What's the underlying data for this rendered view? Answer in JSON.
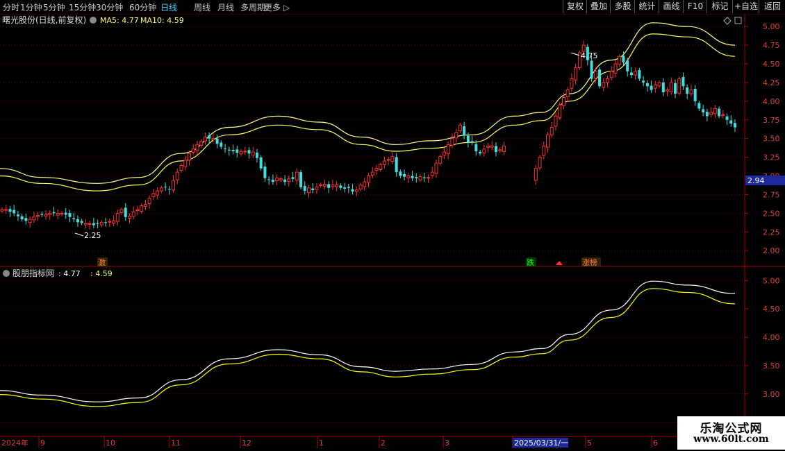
{
  "toolbar": {
    "periods": [
      "分时",
      "1分钟",
      "5分钟",
      "15分钟",
      "30分钟",
      "60分钟",
      "日线",
      "周线",
      "月线",
      "多周期",
      "更多"
    ],
    "active_period": "日线",
    "right_buttons": [
      "复权",
      "叠加",
      "多股",
      "统计",
      "画线",
      "F10",
      "标记",
      "+自选",
      "返回"
    ]
  },
  "upper_panel": {
    "title": "曙光股份(日线,前复权)",
    "ma5_label": "MA5: 4.77",
    "ma10_label": "MA10: 4.59",
    "ma5_color": "#ffffff",
    "ma10_color": "#ffff00",
    "current_price_tag": "2.94",
    "high_marker": "4.75",
    "low_marker": "2.25",
    "event_tags": [
      {
        "text": "激",
        "color": "#ff8040"
      },
      {
        "text": "跌",
        "color": "#00ff00"
      },
      {
        "text": "涨榜",
        "color": "#ff8040"
      }
    ]
  },
  "lower_panel": {
    "title": "股朋指标网",
    "value1": ": 4.77",
    "value2": ": 4.59"
  },
  "x_axis": {
    "labels": [
      "2024年",
      "9",
      "10",
      "11",
      "12",
      "1",
      "2",
      "3",
      "2025/03/31/一",
      "5",
      "6"
    ]
  },
  "chart_data": [
    {
      "type": "candlestick",
      "ylim": [
        1.9,
        5.15
      ],
      "yticks": [
        2.0,
        2.25,
        2.5,
        2.75,
        3.0,
        3.25,
        3.5,
        3.75,
        4.0,
        4.25,
        4.5,
        4.75,
        5.0
      ],
      "bands": {
        "upper": [
          [
            0,
            3.1
          ],
          [
            60,
            2.98
          ],
          [
            140,
            2.9
          ],
          [
            200,
            2.98
          ],
          [
            260,
            3.3
          ],
          [
            330,
            3.65
          ],
          [
            400,
            3.8
          ],
          [
            460,
            3.72
          ],
          [
            520,
            3.52
          ],
          [
            570,
            3.42
          ],
          [
            620,
            3.47
          ],
          [
            680,
            3.55
          ],
          [
            740,
            3.8
          ],
          [
            780,
            3.85
          ],
          [
            820,
            4.1
          ],
          [
            880,
            4.55
          ],
          [
            940,
            5.05
          ],
          [
            990,
            5.0
          ],
          [
            1058,
            4.75
          ]
        ],
        "lower": [
          [
            0,
            3.0
          ],
          [
            60,
            2.9
          ],
          [
            140,
            2.8
          ],
          [
            200,
            2.88
          ],
          [
            260,
            3.2
          ],
          [
            330,
            3.55
          ],
          [
            400,
            3.68
          ],
          [
            460,
            3.62
          ],
          [
            520,
            3.42
          ],
          [
            570,
            3.33
          ],
          [
            620,
            3.37
          ],
          [
            680,
            3.45
          ],
          [
            740,
            3.68
          ],
          [
            780,
            3.74
          ],
          [
            820,
            4.0
          ],
          [
            880,
            4.4
          ],
          [
            940,
            4.9
          ],
          [
            990,
            4.86
          ],
          [
            1058,
            4.6
          ]
        ]
      },
      "close": [
        2.55,
        2.55,
        2.52,
        2.5,
        2.46,
        2.42,
        2.4,
        2.42,
        2.45,
        2.47,
        2.48,
        2.48,
        2.5,
        2.5,
        2.5,
        2.5,
        2.48,
        2.45,
        2.42,
        2.38,
        2.37,
        2.36,
        2.36,
        2.34,
        2.36,
        2.38,
        2.37,
        2.39,
        2.4,
        2.5,
        2.55,
        2.45,
        2.46,
        2.52,
        2.55,
        2.6,
        2.62,
        2.7,
        2.76,
        2.8,
        2.84,
        2.85,
        2.82,
        2.94,
        3.05,
        3.14,
        3.21,
        3.3,
        3.36,
        3.42,
        3.46,
        3.52,
        3.5,
        3.5,
        3.43,
        3.39,
        3.36,
        3.34,
        3.33,
        3.31,
        3.33,
        3.33,
        3.3,
        3.32,
        3.24,
        3.1,
        2.97,
        2.95,
        2.92,
        2.97,
        2.96,
        2.92,
        2.96,
        2.96,
        3.05,
        2.85,
        2.8,
        2.84,
        2.81,
        2.85,
        2.88,
        2.89,
        2.84,
        2.88,
        2.88,
        2.84,
        2.83,
        2.84,
        2.79,
        2.81,
        2.88,
        2.92,
        3.0,
        3.05,
        3.1,
        3.15,
        3.2,
        3.22,
        3.26,
        3.05,
        3.0,
        2.99,
        3.0,
        2.97,
        2.97,
        2.99,
        2.97,
        2.98,
        3.05,
        3.17,
        3.26,
        3.32,
        3.42,
        3.5,
        3.58,
        3.68,
        3.54,
        3.45,
        3.45,
        3.33,
        3.3,
        3.36,
        3.4,
        3.4,
        3.32,
        3.35,
        3.4,
        3.48,
        3.45,
        3.5,
        3.3,
        3.1,
        3.0,
        2.95,
        3.1,
        3.25,
        3.4,
        3.55,
        3.65,
        3.8,
        3.95,
        4.05,
        4.15,
        4.3,
        4.45,
        4.65,
        4.75,
        4.55,
        4.3,
        4.4,
        4.2,
        4.25,
        4.3,
        4.4,
        4.5,
        4.6,
        4.52,
        4.4,
        4.35,
        4.4,
        4.3,
        4.25,
        4.2,
        4.15,
        4.22,
        4.25,
        4.12,
        4.15,
        4.25,
        4.1,
        4.3,
        4.2,
        4.1,
        4.15,
        4.0,
        3.9,
        3.85,
        3.8,
        3.85,
        3.9,
        3.8,
        3.82,
        3.75,
        3.7,
        3.65
      ],
      "x_start": 3,
      "x_end": 1058,
      "gap_from_index": 127,
      "gap_to_index": 134
    },
    {
      "type": "line",
      "ylim": [
        2.3,
        5.2
      ],
      "yticks": [
        2.5,
        3.0,
        3.5,
        4.0,
        4.5,
        5.0
      ],
      "series": [
        {
          "color": "#ffffff",
          "points": [
            [
              0,
              3.06
            ],
            [
              60,
              2.98
            ],
            [
              140,
              2.86
            ],
            [
              200,
              2.93
            ],
            [
              260,
              3.25
            ],
            [
              330,
              3.62
            ],
            [
              400,
              3.78
            ],
            [
              460,
              3.69
            ],
            [
              520,
              3.48
            ],
            [
              570,
              3.4
            ],
            [
              620,
              3.44
            ],
            [
              680,
              3.52
            ],
            [
              740,
              3.74
            ],
            [
              780,
              3.8
            ],
            [
              820,
              4.05
            ],
            [
              880,
              4.48
            ],
            [
              940,
              4.99
            ],
            [
              990,
              4.92
            ],
            [
              1058,
              4.77
            ]
          ]
        },
        {
          "color": "#ffff00",
          "points": [
            [
              0,
              2.99
            ],
            [
              60,
              2.91
            ],
            [
              140,
              2.78
            ],
            [
              200,
              2.85
            ],
            [
              260,
              3.16
            ],
            [
              330,
              3.53
            ],
            [
              400,
              3.7
            ],
            [
              460,
              3.62
            ],
            [
              520,
              3.39
            ],
            [
              570,
              3.3
            ],
            [
              620,
              3.35
            ],
            [
              680,
              3.43
            ],
            [
              740,
              3.65
            ],
            [
              780,
              3.71
            ],
            [
              820,
              3.95
            ],
            [
              880,
              4.35
            ],
            [
              940,
              4.86
            ],
            [
              990,
              4.79
            ],
            [
              1058,
              4.59
            ]
          ]
        }
      ]
    }
  ]
}
